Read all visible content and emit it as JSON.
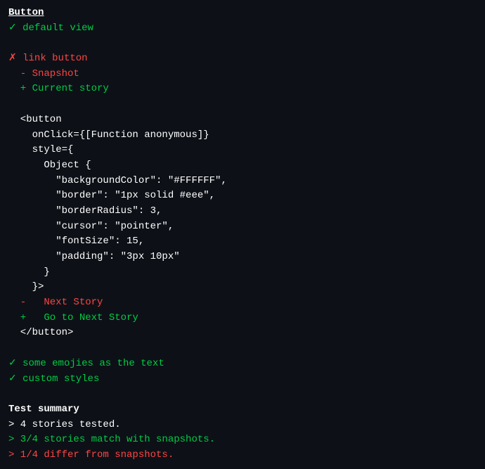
{
  "title": "Button",
  "lines": [
    {
      "id": "title",
      "text": "Button",
      "style": "section-title",
      "indent": 0
    },
    {
      "id": "default-view",
      "text": "✓ default view",
      "style": "green",
      "indent": 0
    },
    {
      "id": "empty1",
      "text": "",
      "indent": 0
    },
    {
      "id": "link-button-label",
      "text": "✗ link button",
      "style": "red",
      "indent": 0
    },
    {
      "id": "snapshot-minus",
      "text": "  - Snapshot",
      "style": "red",
      "indent": 0
    },
    {
      "id": "current-story-plus",
      "text": "  + Current story",
      "style": "green",
      "indent": 0
    },
    {
      "id": "empty2",
      "text": "",
      "indent": 0
    },
    {
      "id": "button-tag-open",
      "text": "  <button",
      "style": "white",
      "indent": 0
    },
    {
      "id": "onclick-attr",
      "text": "    onClick={[Function anonymous]}",
      "style": "white",
      "indent": 0
    },
    {
      "id": "style-attr",
      "text": "    style={",
      "style": "white",
      "indent": 0
    },
    {
      "id": "object-open",
      "text": "      Object {",
      "style": "white",
      "indent": 0
    },
    {
      "id": "bg-color",
      "text": "        \"backgroundColor\": \"#FFFFFF\",",
      "style": "white",
      "indent": 0
    },
    {
      "id": "border",
      "text": "        \"border\": \"1px solid #eee\",",
      "style": "white",
      "indent": 0
    },
    {
      "id": "border-radius",
      "text": "        \"borderRadius\": 3,",
      "style": "white",
      "indent": 0
    },
    {
      "id": "cursor",
      "text": "        \"cursor\": \"pointer\",",
      "style": "white",
      "indent": 0
    },
    {
      "id": "font-size",
      "text": "        \"fontSize\": 15,",
      "style": "white",
      "indent": 0
    },
    {
      "id": "padding",
      "text": "        \"padding\": \"3px 10px\"",
      "style": "white",
      "indent": 0
    },
    {
      "id": "object-close",
      "text": "      }",
      "style": "white",
      "indent": 0
    },
    {
      "id": "style-close",
      "text": "    }>",
      "style": "white",
      "indent": 0
    },
    {
      "id": "next-story-minus",
      "text": "  -   Next Story",
      "style": "red",
      "indent": 0
    },
    {
      "id": "go-to-next-story-plus",
      "text": "  +   Go to Next Story",
      "style": "green",
      "indent": 0
    },
    {
      "id": "button-tag-close",
      "text": "  </button>",
      "style": "white",
      "indent": 0
    },
    {
      "id": "empty3",
      "text": "",
      "indent": 0
    },
    {
      "id": "some-emojies",
      "text": "✓ some emojies as the text",
      "style": "green",
      "indent": 0
    },
    {
      "id": "custom-styles",
      "text": "✓ custom styles",
      "style": "green",
      "indent": 0
    },
    {
      "id": "empty4",
      "text": "",
      "indent": 0
    },
    {
      "id": "test-summary-title",
      "text": "Test summary",
      "style": "bold white",
      "indent": 0
    },
    {
      "id": "stories-tested",
      "text": "> 4 stories tested.",
      "style": "white",
      "indent": 0
    },
    {
      "id": "stories-match",
      "text": "> 3/4 stories match with snapshots.",
      "style": "green",
      "indent": 0
    },
    {
      "id": "stories-differ",
      "text": "> 1/4 differ from snapshots.",
      "style": "red",
      "indent": 0
    }
  ]
}
